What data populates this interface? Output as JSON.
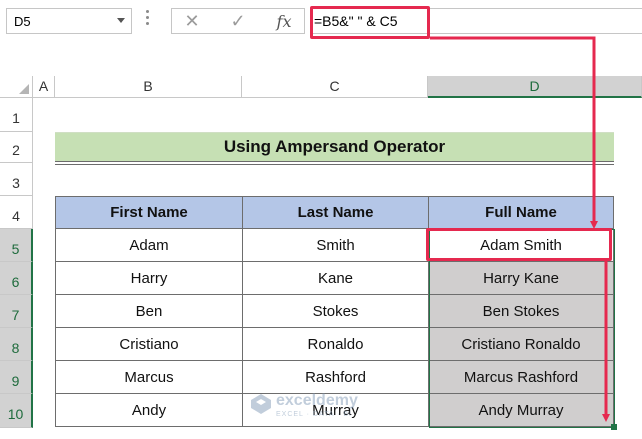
{
  "formula_bar": {
    "name_box": "D5",
    "cancel_icon": "✕",
    "enter_icon": "✓",
    "fx_label": "fx",
    "formula": "=B5&\" \" & C5"
  },
  "columns": [
    "A",
    "B",
    "C",
    "D"
  ],
  "rows": [
    "1",
    "2",
    "3",
    "4",
    "5",
    "6",
    "7",
    "8",
    "9",
    "10"
  ],
  "title": "Using Ampersand Operator",
  "table": {
    "headers": [
      "First Name",
      "Last Name",
      "Full Name"
    ],
    "rows": [
      [
        "Adam",
        "Smith",
        "Adam  Smith"
      ],
      [
        "Harry",
        "Kane",
        "Harry  Kane"
      ],
      [
        "Ben",
        "Stokes",
        "Ben Stokes"
      ],
      [
        "Cristiano",
        "Ronaldo",
        "Cristiano Ronaldo"
      ],
      [
        "Marcus",
        "Rashford",
        "Marcus  Rashford"
      ],
      [
        "Andy",
        "Murray",
        "Andy Murray"
      ]
    ]
  },
  "watermark": {
    "name": "exceldemy",
    "tagline": "EXCEL · DATA · BI"
  },
  "colors": {
    "highlight": "#e5294f",
    "selection": "#217346",
    "title_fill": "#c6e0b4",
    "header_fill": "#b4c6e7",
    "output_fill": "#d0cece"
  }
}
